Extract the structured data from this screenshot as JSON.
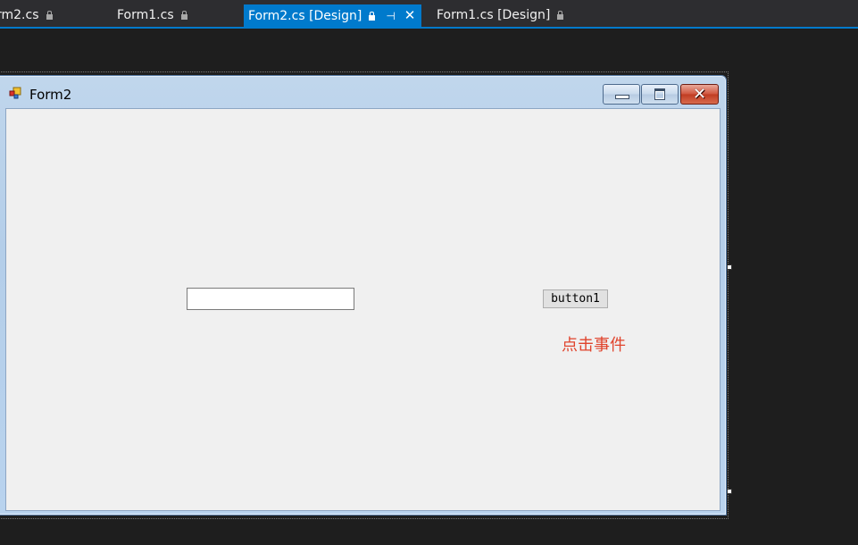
{
  "tabs": [
    {
      "label": "rm2.cs",
      "locked": true,
      "active": false
    },
    {
      "label": "Form1.cs",
      "locked": true,
      "active": false
    },
    {
      "label": "Form2.cs [Design]",
      "locked": true,
      "active": true
    },
    {
      "label": "Form1.cs [Design]",
      "locked": true,
      "active": false
    }
  ],
  "form": {
    "title": "Form2",
    "textbox_value": "",
    "button_label": "button1",
    "label_text": "点击事件"
  },
  "colors": {
    "accent": "#007acc",
    "label": "#e0442d",
    "background": "#1e1e1e",
    "client": "#f0f0f0"
  },
  "icons": {
    "tab_lock": "lock-icon",
    "tab_pin": "pin-icon",
    "tab_close": "close-icon",
    "form_app": "form-app-icon",
    "minimize": "minimize-icon",
    "maximize": "maximize-icon",
    "close": "close-x-icon"
  }
}
